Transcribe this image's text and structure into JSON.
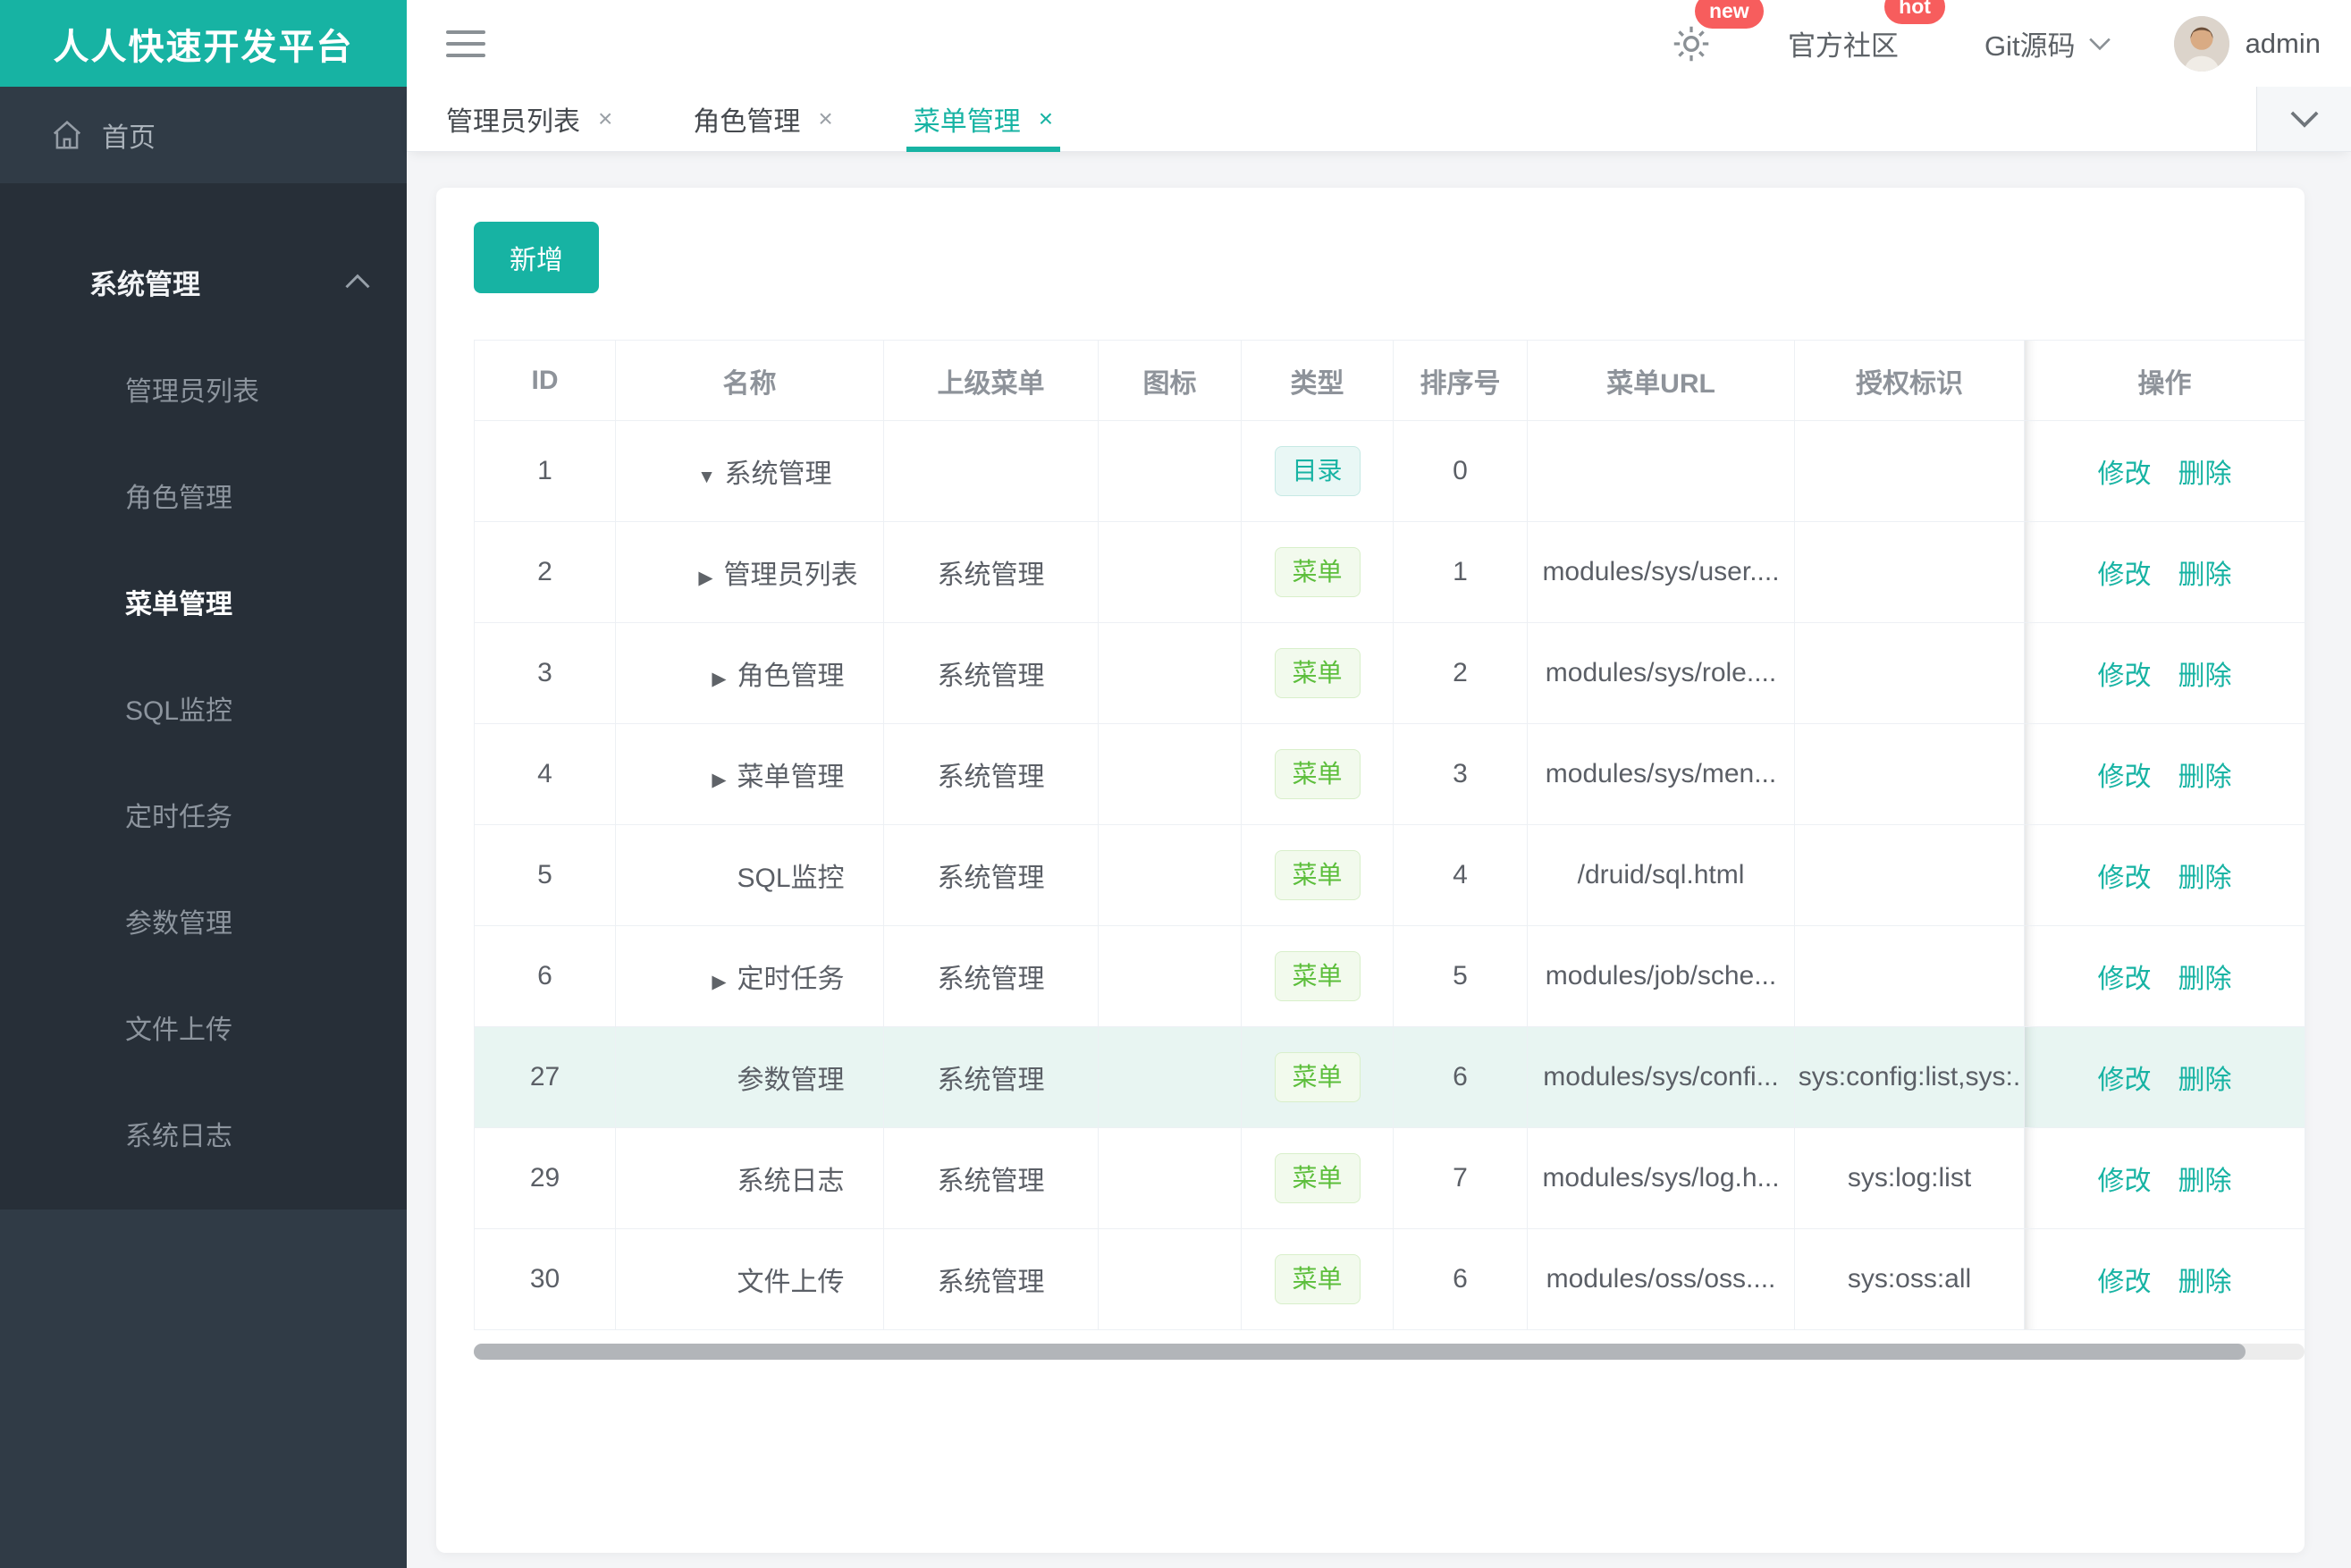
{
  "app": {
    "title": "人人快速开发平台"
  },
  "colors": {
    "accent": "#17b3a3",
    "sidebar_bg": "#303b46",
    "sidebar_submenu_bg": "#272f38",
    "badge_red": "#f75d5d",
    "tag_dir_color": "#17b3a3",
    "tag_menu_color": "#5cbe3b",
    "row_highlight": "#e8f5f2"
  },
  "icons": {
    "close": "×"
  },
  "topbar": {
    "badge_new": "new",
    "badge_hot": "hot",
    "community_label": "官方社区",
    "git_label": "Git源码",
    "username": "admin"
  },
  "sidebar": {
    "home_label": "首页",
    "section_label": "系统管理",
    "items": [
      "管理员列表",
      "角色管理",
      "菜单管理",
      "SQL监控",
      "定时任务",
      "参数管理",
      "文件上传",
      "系统日志"
    ],
    "active_item": "菜单管理"
  },
  "tabs": [
    {
      "label": "管理员列表"
    },
    {
      "label": "角色管理"
    },
    {
      "label": "菜单管理"
    }
  ],
  "toolbar": {
    "add_label": "新增"
  },
  "table": {
    "headers": [
      "ID",
      "名称",
      "上级菜单",
      "图标",
      "类型",
      "排序号",
      "菜单URL",
      "授权标识",
      "操作"
    ],
    "ops": {
      "edit": "修改",
      "delete": "删除"
    },
    "rows": [
      {
        "id": "1",
        "arrow": "▼",
        "name": "系统管理",
        "parent": "",
        "icon": "",
        "type": "目录",
        "order": "0",
        "url": "",
        "perm": ""
      },
      {
        "id": "2",
        "arrow": "▶",
        "name": "管理员列表",
        "parent": "系统管理",
        "icon": "",
        "type": "菜单",
        "order": "1",
        "url": "modules/sys/user....",
        "perm": ""
      },
      {
        "id": "3",
        "arrow": "▶",
        "name": "角色管理",
        "parent": "系统管理",
        "icon": "",
        "type": "菜单",
        "order": "2",
        "url": "modules/sys/role....",
        "perm": ""
      },
      {
        "id": "4",
        "arrow": "▶",
        "name": "菜单管理",
        "parent": "系统管理",
        "icon": "",
        "type": "菜单",
        "order": "3",
        "url": "modules/sys/men...",
        "perm": ""
      },
      {
        "id": "5",
        "arrow": "",
        "name": "SQL监控",
        "parent": "系统管理",
        "icon": "",
        "type": "菜单",
        "order": "4",
        "url": "/druid/sql.html",
        "perm": ""
      },
      {
        "id": "6",
        "arrow": "▶",
        "name": "定时任务",
        "parent": "系统管理",
        "icon": "",
        "type": "菜单",
        "order": "5",
        "url": "modules/job/sche...",
        "perm": ""
      },
      {
        "id": "27",
        "arrow": "",
        "name": "参数管理",
        "parent": "系统管理",
        "icon": "",
        "type": "菜单",
        "order": "6",
        "url": "modules/sys/confi...",
        "perm": "sys:config:list,sys:."
      },
      {
        "id": "29",
        "arrow": "",
        "name": "系统日志",
        "parent": "系统管理",
        "icon": "",
        "type": "菜单",
        "order": "7",
        "url": "modules/sys/log.h...",
        "perm": "sys:log:list"
      },
      {
        "id": "30",
        "arrow": "",
        "name": "文件上传",
        "parent": "系统管理",
        "icon": "",
        "type": "菜单",
        "order": "6",
        "url": "modules/oss/oss....",
        "perm": "sys:oss:all"
      }
    ]
  }
}
